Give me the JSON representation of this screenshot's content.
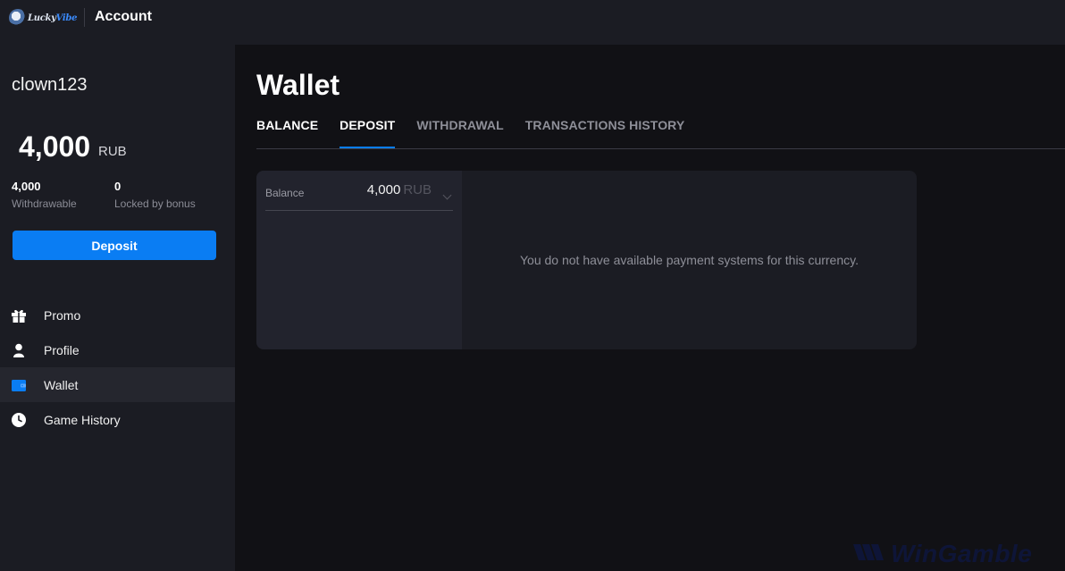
{
  "header": {
    "logo_text_a": "Lucky",
    "logo_text_b": "Vibe",
    "title": "Account"
  },
  "sidebar": {
    "username": "clown123",
    "balance": {
      "amount": "4,000",
      "currency": "RUB"
    },
    "withdrawable": {
      "value": "4,000",
      "label": "Withdrawable"
    },
    "locked": {
      "value": "0",
      "label": "Locked by bonus"
    },
    "deposit_label": "Deposit",
    "nav": [
      {
        "label": "Promo",
        "icon": "gift-icon"
      },
      {
        "label": "Profile",
        "icon": "user-icon"
      },
      {
        "label": "Wallet",
        "icon": "wallet-icon",
        "active": true
      },
      {
        "label": "Game History",
        "icon": "clock-icon"
      }
    ]
  },
  "main": {
    "title": "Wallet",
    "tabs": [
      {
        "label": "BALANCE"
      },
      {
        "label": "DEPOSIT",
        "active": true
      },
      {
        "label": "WITHDRAWAL"
      },
      {
        "label": "TRANSACTIONS HISTORY"
      }
    ],
    "balance_select": {
      "label": "Balance",
      "value": "4,000",
      "currency": "RUB"
    },
    "empty_message": "You do not have available payment systems for this currency."
  },
  "watermark": {
    "text": "WinGamble"
  },
  "colors": {
    "accent": "#0a7df3",
    "background": "#111115",
    "sidebar": "#1b1c23"
  }
}
